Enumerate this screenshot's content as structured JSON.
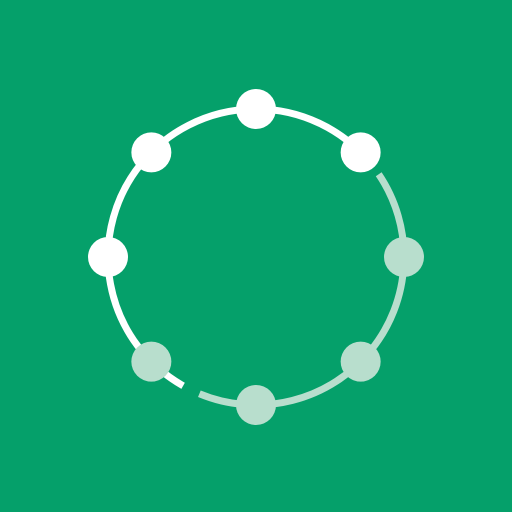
{
  "app_icon": {
    "icon_name": "circular-progress-ring-icon",
    "colors": {
      "background": "#05A06A",
      "active": "#FFFFFF",
      "inactive": "#B8DECD"
    },
    "progress": {
      "completed_steps": 4,
      "total_steps": 8,
      "fraction": 0.5
    }
  }
}
